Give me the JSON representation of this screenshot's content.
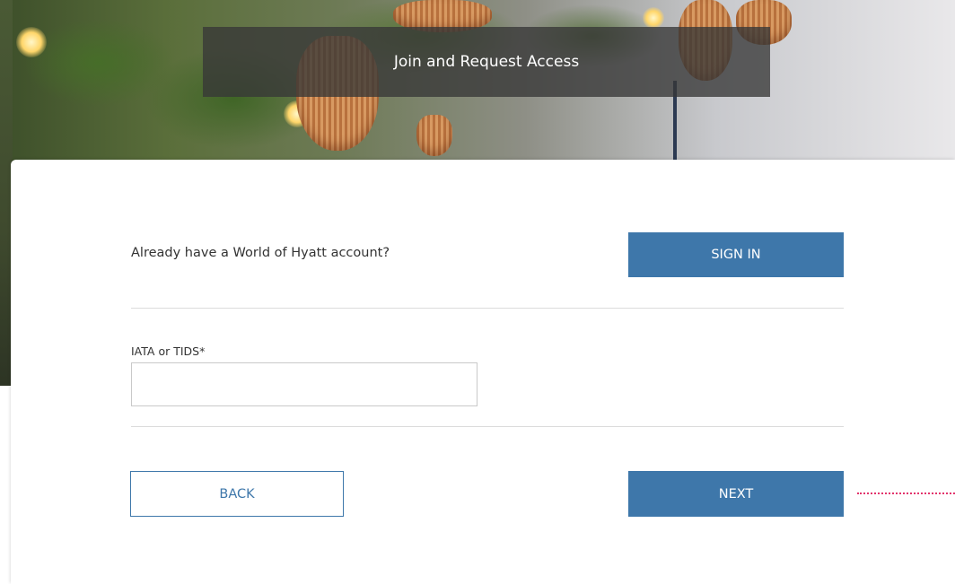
{
  "header": {
    "title": "Join and Request Access"
  },
  "signin_row": {
    "prompt": "Already have a World of Hyatt account?",
    "signin_label": "SIGN IN"
  },
  "iata_field": {
    "label": "IATA or TIDS*",
    "value": "",
    "placeholder": ""
  },
  "actions": {
    "back_label": "BACK",
    "next_label": "NEXT"
  },
  "colors": {
    "primary": "#3e77aa",
    "annotation": "#e2336b"
  }
}
